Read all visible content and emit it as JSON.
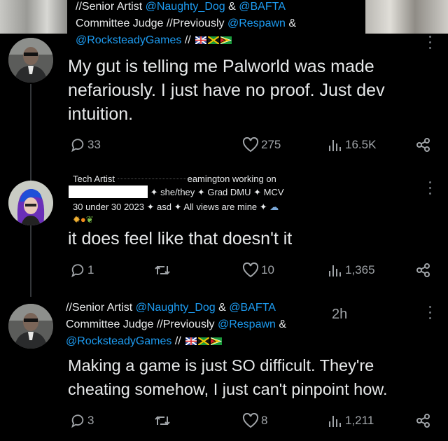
{
  "tweet1": {
    "bio_line1_prefix": "//Senior Artist ",
    "bio_link1": "@Naughty_Dog",
    "bio_and1": " & ",
    "bio_link2": "@BAFTA",
    "bio_line2_prefix": "Committee Judge //Previously ",
    "bio_link3": "@Respawn",
    "bio_and2": " &",
    "bio_link4": "@RocksteadyGames",
    "bio_suffix": " //",
    "text_lines": [
      "My gut is telling me Palworld was made",
      "nefariously. I just have no proof. Just dev",
      "intuition."
    ],
    "replies": "33",
    "likes": "275",
    "views": "16.5K"
  },
  "tweet2": {
    "bio_line1": "Tech Artist",
    "bio_line1_tail": "eamington working on",
    "bio_line2": "✦ she/they ✦ Grad DMU ✦ MCV",
    "bio_line3": "30 under 30 2023 ✦ asd ✦ All views are mine ✦",
    "text": "it does feel like that doesn't it",
    "replies": "1",
    "likes": "10",
    "views": "1,365"
  },
  "tweet3": {
    "bio_line1_prefix": "//Senior Artist ",
    "bio_link1": "@Naughty_Dog",
    "bio_and1": " & ",
    "bio_link2": "@BAFTA",
    "bio_line2_prefix": "Committee Judge //Previously ",
    "bio_link3": "@Respawn",
    "bio_and2": " &",
    "bio_link4": "@RocksteadyGames",
    "bio_suffix": " //",
    "timestamp": "2h",
    "text_lines": [
      "Making a game is just SO difficult. They're",
      "cheating somehow, I just can't pinpoint how."
    ],
    "replies": "3",
    "likes": "8",
    "views": "1,211"
  },
  "icons": {
    "reply": "reply-icon",
    "retweet": "retweet-icon",
    "like": "heart-icon",
    "views": "views-icon",
    "share": "share-icon",
    "more": "more-icon"
  },
  "colors": {
    "background": "#000000",
    "text": "#e7e9ea",
    "link": "#1d9bf0",
    "muted": "#71767b"
  }
}
